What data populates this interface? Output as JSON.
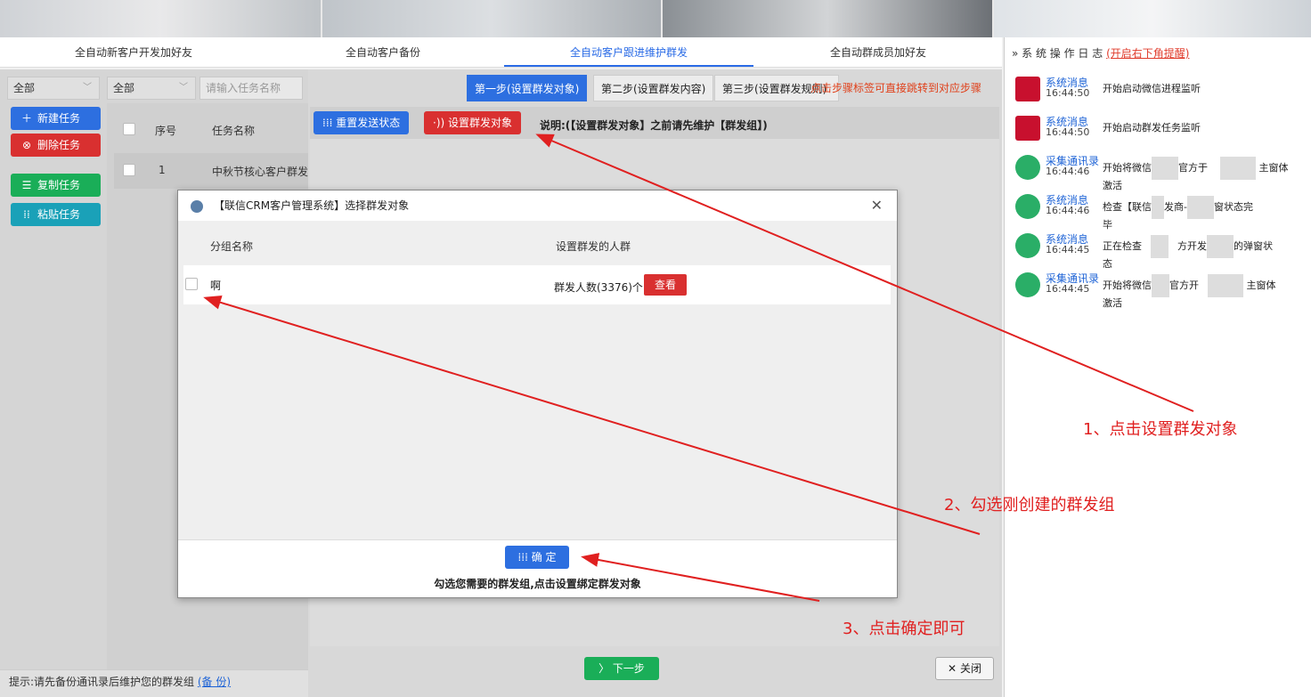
{
  "tabs": [
    "全自动新客户开发加好友",
    "全自动客户备份",
    "全自动客户跟进维护群发",
    "全自动群成员加好友"
  ],
  "log": {
    "title": "系 统 操 作 日 志",
    "link": "(开启右下角提醒)",
    "items": [
      {
        "title": "系统消息",
        "time": "16:44:50",
        "msg": "开始启动微信进程监听"
      },
      {
        "title": "系统消息",
        "time": "16:44:50",
        "msg": "开始启动群发任务监听"
      },
      {
        "title": "采集通讯录",
        "time": "16:44:46",
        "msg1": "开始将微信",
        "msg2": "官方于",
        "msg3": "主窗体",
        "msg4": "激活"
      },
      {
        "title": "系统消息",
        "time": "16:44:46",
        "msg1": "检查【联信",
        "msg2": "发商-",
        "msg3": "窗状态完",
        "msg4": "毕"
      },
      {
        "title": "系统消息",
        "time": "16:44:45",
        "msg1": "正在检查",
        "msg2": "方开发",
        "msg3": "的弹窗状",
        "msg4": "态"
      },
      {
        "title": "采集通讯录",
        "time": "16:44:45",
        "msg1": "开始将微信",
        "msg2": "官方开",
        "msg3": "主窗体",
        "msg4": "激活"
      }
    ]
  },
  "left": {
    "filter1": "全部",
    "filter2": "全部",
    "search_placeholder": "请输入任务名称",
    "new_task": "新建任务",
    "delete_task": "删除任务",
    "copy_task": "复制任务",
    "paste_task": "粘贴任务",
    "col_index": "序号",
    "col_name": "任务名称",
    "row_index": "1",
    "row_name": "中秋节核心客户群发",
    "hint": "提示:请先备份通讯录后维护您的群发组",
    "hint_link": "(备 份)"
  },
  "center": {
    "step1": "第一步(设置群发对象)",
    "step2": "第二步(设置群发内容)",
    "step3": "第三步(设置群发规则)",
    "step_hint": "点击步骤标签可直接跳转到对应步骤",
    "reset_btn": "重置发送状态",
    "set_target_btn": "设置群发对象",
    "desc": "说明:(【设置群发对象】之前请先维护【群发组】)",
    "next_btn": "下一步",
    "close_btn": "关闭"
  },
  "modal": {
    "title": "【联信CRM客户管理系统】选择群发对象",
    "col_group": "分组名称",
    "col_crowd": "设置群发的人群",
    "row_name": "啊",
    "row_count": "群发人数(3376)个",
    "view_btn": "查看",
    "ok_btn": "确 定",
    "footer_text": "勾选您需要的群发组,点击设置绑定群发对象"
  },
  "annotations": {
    "a1": "1、点击设置群发对象",
    "a2": "2、勾选刚创建的群发组",
    "a3": "3、点击确定即可"
  },
  "colors": {
    "accent_blue": "#2d6fe0",
    "danger_red": "#d93030",
    "success_green": "#1aae58",
    "annotation_red": "#e02020"
  }
}
